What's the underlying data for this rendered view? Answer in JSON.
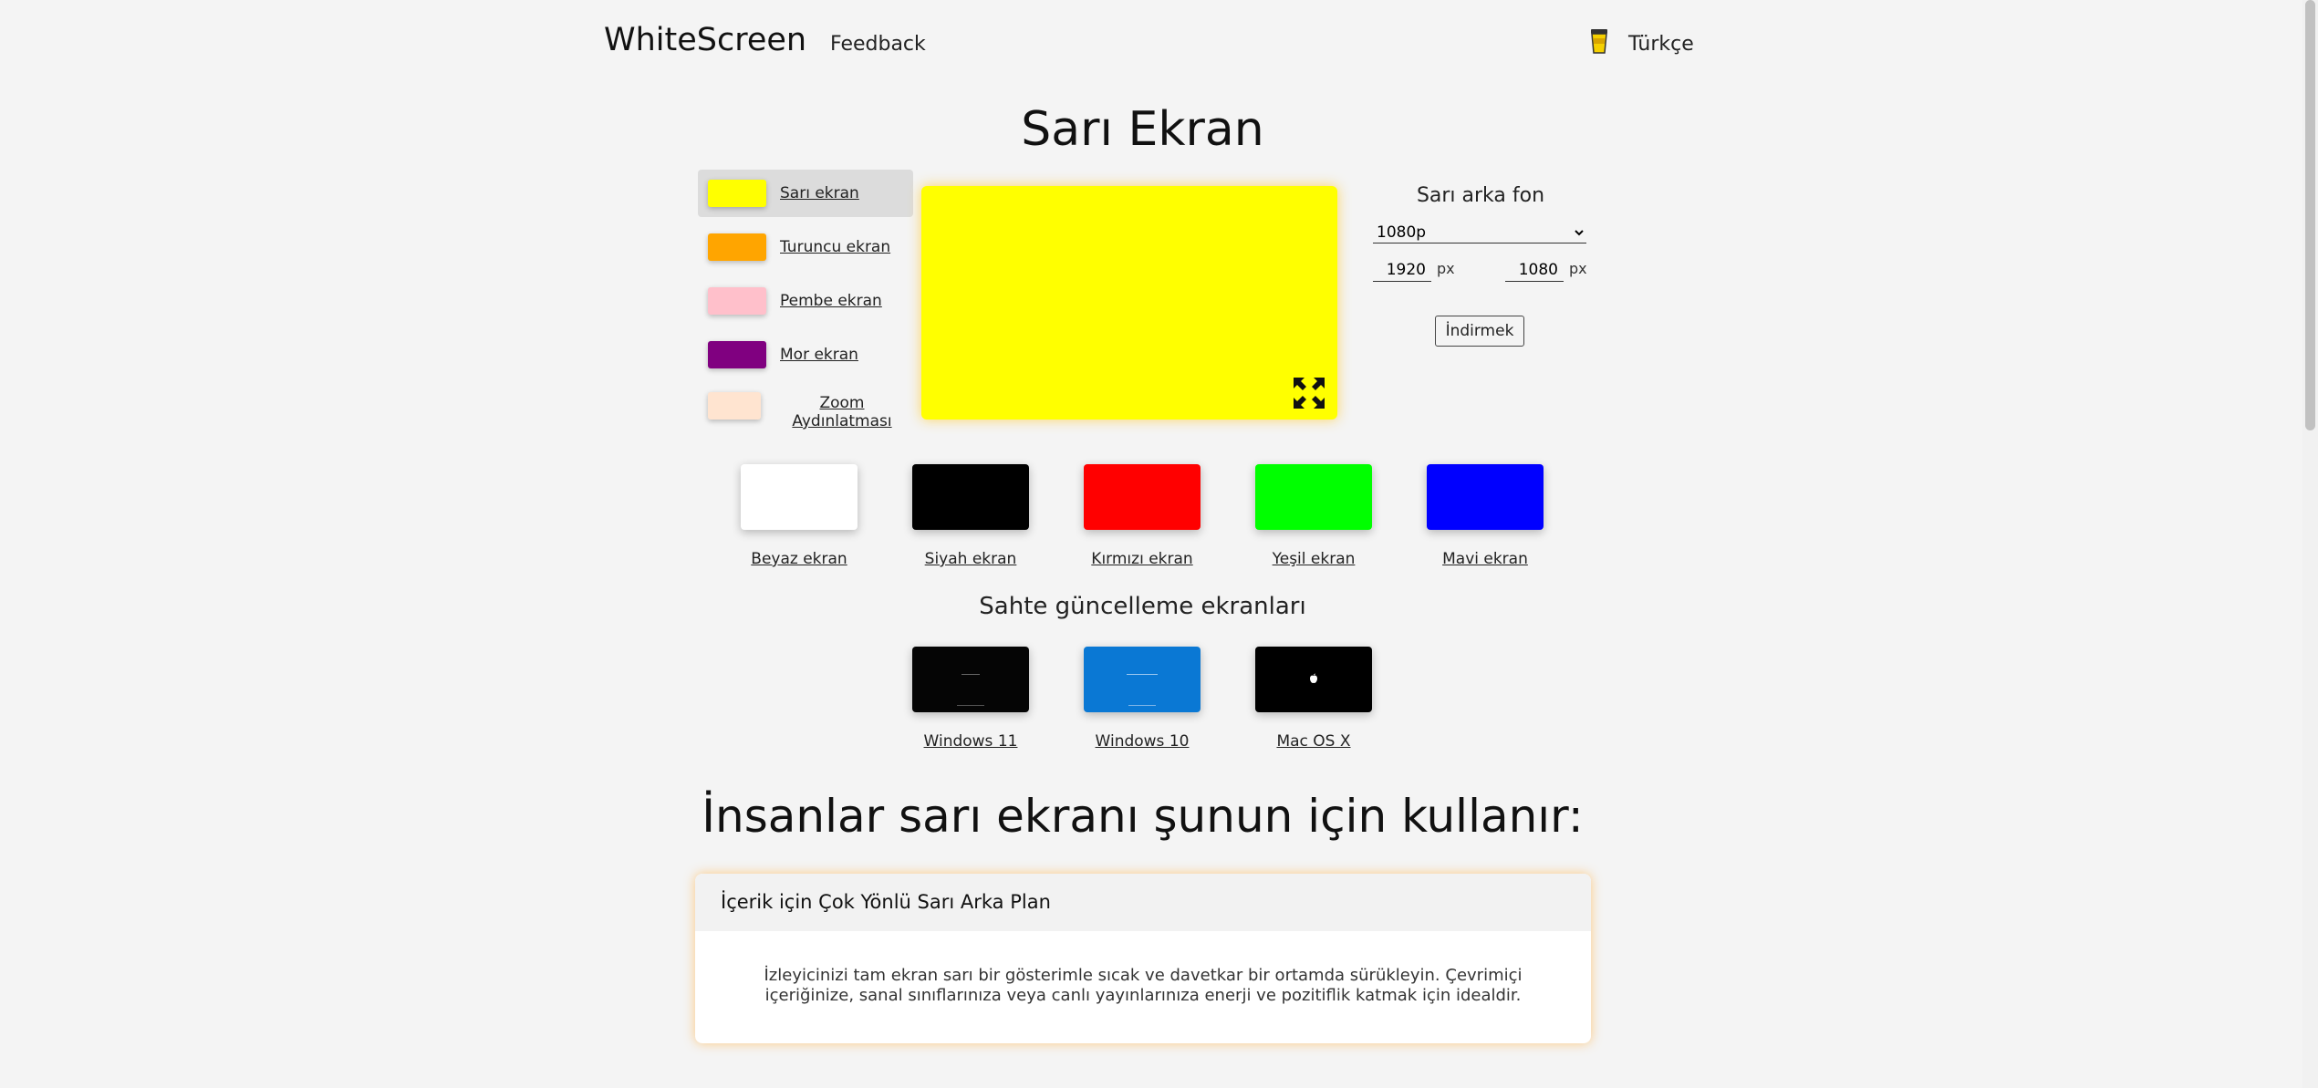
{
  "header": {
    "logo": "WhiteScreen",
    "feedback": "Feedback",
    "language": "Türkçe"
  },
  "title": "Sarı Ekran",
  "colors": [
    {
      "label": "Sarı ekran",
      "color": "#ffff00",
      "active": true
    },
    {
      "label": "Turuncu ekran",
      "color": "#ffa500"
    },
    {
      "label": "Pembe ekran",
      "color": "#ffc0cb"
    },
    {
      "label": "Mor ekran",
      "color": "#800080"
    },
    {
      "label": "Zoom Aydınlatması",
      "color": "#ffe4d0"
    }
  ],
  "preview_color": "#ffff00",
  "controls": {
    "title": "Sarı arka fon",
    "resolution": "1080p",
    "width": "1920",
    "height": "1080",
    "unit": "px",
    "download": "İndirmek"
  },
  "grid": [
    {
      "label": "Beyaz ekran",
      "color": "#ffffff"
    },
    {
      "label": "Siyah ekran",
      "color": "#000000"
    },
    {
      "label": "Kırmızı ekran",
      "color": "#ff0000"
    },
    {
      "label": "Yeşil ekran",
      "color": "#00ff00"
    },
    {
      "label": "Mavi ekran",
      "color": "#0000ff"
    }
  ],
  "fake": {
    "title": "Sahte güncelleme ekranları",
    "items": [
      "Windows 11",
      "Windows 10",
      "Mac OS X"
    ]
  },
  "uses": {
    "title": "İnsanlar sarı ekranı şunun için kullanır:",
    "card_title": "İçerik için Çok Yönlü Sarı Arka Plan",
    "card_text": "İzleyicinizi tam ekran sarı bir gösterimle sıcak ve davetkar bir ortamda sürükleyin. Çevrimiçi içeriğinize, sanal sınıflarınıza veya canlı yayınlarınıza enerji ve pozitiflik katmak için idealdir."
  }
}
